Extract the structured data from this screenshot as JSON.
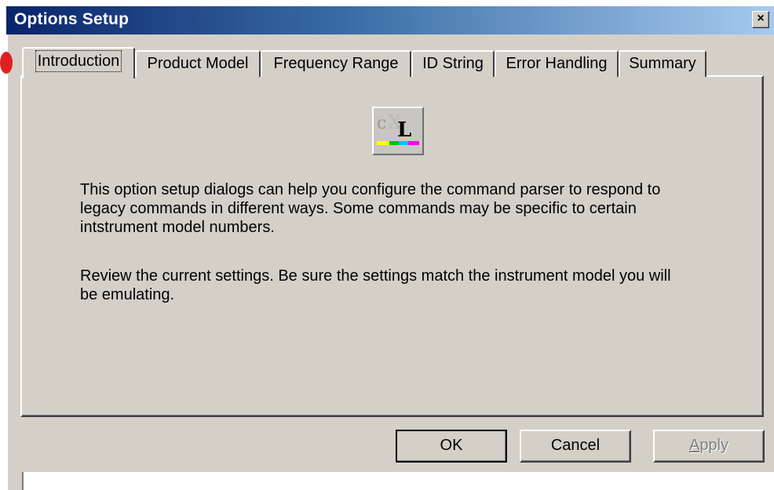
{
  "window": {
    "title": "Options Setup",
    "close_label": "×"
  },
  "tabs": [
    {
      "label": "Introduction",
      "active": true
    },
    {
      "label": "Product Model",
      "active": false
    },
    {
      "label": "Frequency Range",
      "active": false
    },
    {
      "label": "ID String",
      "active": false
    },
    {
      "label": "Error Handling",
      "active": false
    },
    {
      "label": "Summary",
      "active": false
    }
  ],
  "logo": {
    "text_c": "c",
    "text_x": "X",
    "text_l": "L",
    "icon": "cxl-logo-icon",
    "stripe_colors": [
      "#ffff00",
      "#00c000",
      "#00c0ff",
      "#ff00ff"
    ]
  },
  "intro": {
    "paragraph1": [
      "This option setup dialogs can help you configure the command parser to respond to",
      "legacy commands in different ways.  Some commands may be specific to certain",
      "intstrument model numbers."
    ],
    "paragraph2": [
      "Review the current settings.  Be sure the settings match the instrument model you will",
      "be emulating."
    ]
  },
  "buttons": {
    "ok": "OK",
    "cancel": "Cancel",
    "apply_prefix": "A",
    "apply_rest": "pply"
  },
  "colors": {
    "face": "#d4d0c8",
    "title_start": "#0a246a",
    "title_end": "#a6caf0",
    "disabled_text": "#808080"
  }
}
